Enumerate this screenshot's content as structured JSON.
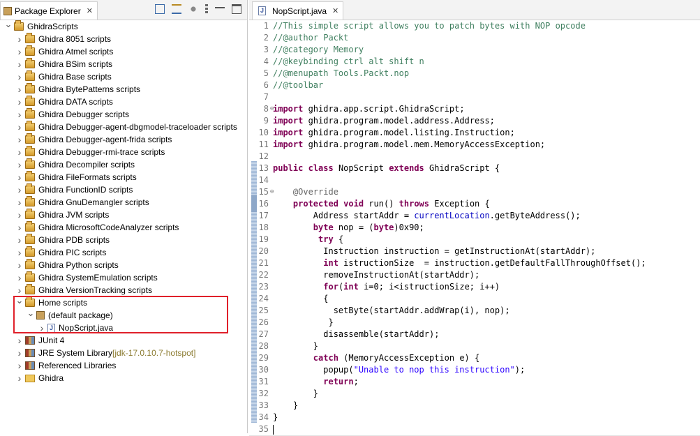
{
  "explorer": {
    "tab_label": "Package Explorer",
    "close": "✕",
    "tree": [
      {
        "label": "GhidraScripts",
        "level": 0,
        "icon": "project-folder-icon",
        "expanded": true
      },
      {
        "label": "Ghidra 8051 scripts",
        "level": 1,
        "icon": "project-folder-icon"
      },
      {
        "label": "Ghidra Atmel scripts",
        "level": 1,
        "icon": "project-folder-icon"
      },
      {
        "label": "Ghidra BSim scripts",
        "level": 1,
        "icon": "project-folder-icon"
      },
      {
        "label": "Ghidra Base scripts",
        "level": 1,
        "icon": "project-folder-icon"
      },
      {
        "label": "Ghidra BytePatterns scripts",
        "level": 1,
        "icon": "project-folder-icon"
      },
      {
        "label": "Ghidra DATA scripts",
        "level": 1,
        "icon": "project-folder-icon"
      },
      {
        "label": "Ghidra Debugger scripts",
        "level": 1,
        "icon": "project-folder-icon"
      },
      {
        "label": "Ghidra Debugger-agent-dbgmodel-traceloader scripts",
        "level": 1,
        "icon": "project-folder-icon"
      },
      {
        "label": "Ghidra Debugger-agent-frida scripts",
        "level": 1,
        "icon": "project-folder-icon"
      },
      {
        "label": "Ghidra Debugger-rmi-trace scripts",
        "level": 1,
        "icon": "project-folder-icon"
      },
      {
        "label": "Ghidra Decompiler scripts",
        "level": 1,
        "icon": "project-folder-icon"
      },
      {
        "label": "Ghidra FileFormats scripts",
        "level": 1,
        "icon": "project-folder-icon"
      },
      {
        "label": "Ghidra FunctionID scripts",
        "level": 1,
        "icon": "project-folder-icon"
      },
      {
        "label": "Ghidra GnuDemangler scripts",
        "level": 1,
        "icon": "project-folder-icon"
      },
      {
        "label": "Ghidra JVM scripts",
        "level": 1,
        "icon": "project-folder-icon"
      },
      {
        "label": "Ghidra MicrosoftCodeAnalyzer scripts",
        "level": 1,
        "icon": "project-folder-icon"
      },
      {
        "label": "Ghidra PDB scripts",
        "level": 1,
        "icon": "project-folder-icon"
      },
      {
        "label": "Ghidra PIC scripts",
        "level": 1,
        "icon": "project-folder-icon"
      },
      {
        "label": "Ghidra Python scripts",
        "level": 1,
        "icon": "project-folder-icon"
      },
      {
        "label": "Ghidra SystemEmulation scripts",
        "level": 1,
        "icon": "project-folder-icon"
      },
      {
        "label": "Ghidra VersionTracking scripts",
        "level": 1,
        "icon": "project-folder-icon"
      },
      {
        "label": "Home scripts",
        "level": 1,
        "icon": "project-folder-icon",
        "expanded": true
      },
      {
        "label": "(default package)",
        "level": 2,
        "icon": "package-icon",
        "expanded": true
      },
      {
        "label": "NopScript.java",
        "level": 3,
        "icon": "java-file-icon"
      },
      {
        "label": "JUnit 4",
        "level": 1,
        "icon": "library-icon"
      },
      {
        "label": "JRE System Library",
        "annotation": "[jdk-17.0.10.7-hotspot]",
        "level": 1,
        "icon": "library-icon"
      },
      {
        "label": "Referenced Libraries",
        "level": 1,
        "icon": "library-icon"
      },
      {
        "label": "Ghidra",
        "level": 1,
        "icon": "folder-icon"
      }
    ]
  },
  "editor": {
    "tab_label": "NopScript.java",
    "close": "✕",
    "lines": [
      {
        "n": "1",
        "text": "//This simple script allows you to patch bytes with NOP opcode"
      },
      {
        "n": "2",
        "text": "//@author Packt"
      },
      {
        "n": "3",
        "text": "//@category Memory"
      },
      {
        "n": "4",
        "text": "//@keybinding ctrl alt shift n"
      },
      {
        "n": "5",
        "text": "//@menupath Tools.Packt.nop"
      },
      {
        "n": "6",
        "text": "//@toolbar"
      },
      {
        "n": "7",
        "text": ""
      },
      {
        "n": "8",
        "text": "import ghidra.app.script.GhidraScript;",
        "fold": true
      },
      {
        "n": "9",
        "text": "import ghidra.program.model.address.Address;"
      },
      {
        "n": "10",
        "text": "import ghidra.program.model.listing.Instruction;"
      },
      {
        "n": "11",
        "text": "import ghidra.program.model.mem.MemoryAccessException;"
      },
      {
        "n": "12",
        "text": ""
      },
      {
        "n": "13",
        "text": "public class NopScript extends GhidraScript {"
      },
      {
        "n": "14",
        "text": ""
      },
      {
        "n": "15",
        "text": "    @Override",
        "fold": true
      },
      {
        "n": "16",
        "text": "    protected void run() throws Exception {"
      },
      {
        "n": "17",
        "text": "        Address startAddr = currentLocation.getByteAddress();"
      },
      {
        "n": "18",
        "text": "        byte nop = (byte)0x90;"
      },
      {
        "n": "19",
        "text": "         try {"
      },
      {
        "n": "20",
        "text": "          Instruction instruction = getInstructionAt(startAddr);"
      },
      {
        "n": "21",
        "text": "          int istructionSize  = instruction.getDefaultFallThroughOffset();"
      },
      {
        "n": "22",
        "text": "          removeInstructionAt(startAddr);"
      },
      {
        "n": "23",
        "text": "          for(int i=0; i<istructionSize; i++)"
      },
      {
        "n": "24",
        "text": "          {"
      },
      {
        "n": "25",
        "text": "            setByte(startAddr.addWrap(i), nop);"
      },
      {
        "n": "26",
        "text": "           }"
      },
      {
        "n": "27",
        "text": "          disassemble(startAddr);"
      },
      {
        "n": "28",
        "text": "        }"
      },
      {
        "n": "29",
        "text": "        catch (MemoryAccessException e) {"
      },
      {
        "n": "30",
        "text": "          popup(\"Unable to nop this instruction\");"
      },
      {
        "n": "31",
        "text": "          return;"
      },
      {
        "n": "32",
        "text": "        }"
      },
      {
        "n": "33",
        "text": "    }"
      },
      {
        "n": "34",
        "text": "}"
      },
      {
        "n": "35",
        "text": ""
      }
    ]
  },
  "colors": {
    "keyword": "#7f0055",
    "comment": "#3f7f5f",
    "field": "#0000c0",
    "string": "#2a00ff",
    "annotation": "#646464",
    "highlight_box": "#e0202a"
  }
}
